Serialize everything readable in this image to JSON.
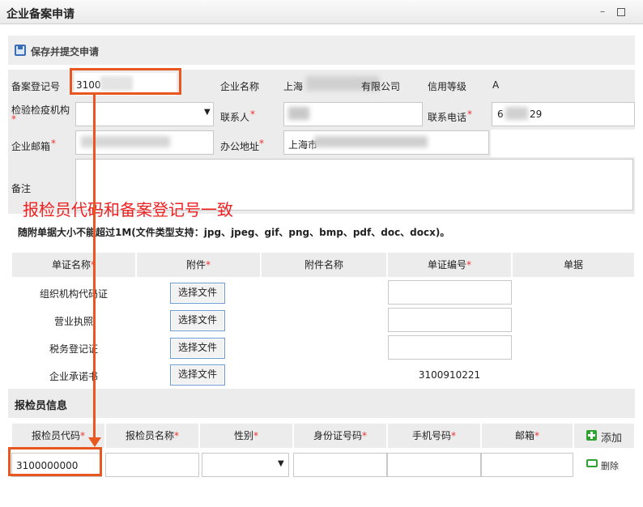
{
  "window": {
    "title": "企业备案申请"
  },
  "toolbar": {
    "save_label": "保存并提交申请"
  },
  "form": {
    "record_no_label": "备案登记号",
    "record_no_value": "3100",
    "company_name_label": "企业名称",
    "company_name_value_prefix": "上海",
    "company_name_value_suffix": "有限公司",
    "credit_label": "信用等级",
    "credit_value": "A",
    "inspection_org_label": "检验检疫机构",
    "contact_label": "联系人",
    "phone_label": "联系电话",
    "phone_value_prefix": "6",
    "phone_value_suffix": "29",
    "email_label": "企业邮箱",
    "office_addr_label": "办公地址",
    "office_addr_value": "上海市",
    "remark_label": "备注",
    "required_mark": "*"
  },
  "annotation": "报检员代码和备案登记号一致",
  "attachment_hint": "随附单据大小不能超过1M(文件类型支持：jpg、jpeg、gif、png、bmp、pdf、doc、docx)。",
  "doc_table": {
    "headers": [
      "单证名称",
      "附件",
      "附件名称",
      "单证编号",
      "单据"
    ],
    "rows": [
      {
        "name": "组织机构代码证",
        "button": "选择文件",
        "doc_no": ""
      },
      {
        "name": "营业执照",
        "button": "选择文件",
        "doc_no": ""
      },
      {
        "name": "税务登记证",
        "button": "选择文件",
        "doc_no": ""
      },
      {
        "name": "企业承诺书",
        "button": "选择文件",
        "doc_no": "3100910221"
      }
    ]
  },
  "inspector": {
    "section_title": "报检员信息",
    "headers": [
      "报检员代码",
      "报检员名称",
      "性别",
      "身份证号码",
      "手机号码",
      "邮箱"
    ],
    "add_label": "添加",
    "delete_label": "删除",
    "code_value": "3100000000"
  },
  "colors": {
    "accent_red": "#e22222",
    "arrow": "#e8571f",
    "add_green": "#2fa32f"
  }
}
